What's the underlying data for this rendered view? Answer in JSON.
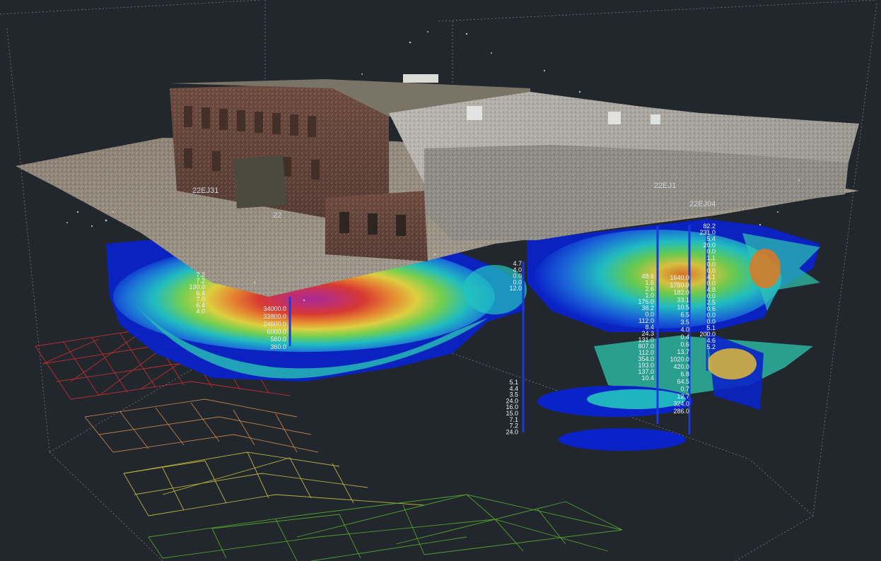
{
  "boreholes": [
    {
      "id": "22EJ31"
    },
    {
      "id": "22EJ04"
    },
    {
      "id": "22EJ1"
    },
    {
      "id": "22"
    }
  ],
  "sample_columns": [
    {
      "values": [
        "7.2",
        "7.2",
        "130.0",
        "6.4",
        "7.0",
        "6.4",
        "4.0"
      ]
    },
    {
      "values": [
        "34000.0",
        "33800.0",
        "24600.0",
        "6000.0",
        "560.0",
        "360.0"
      ]
    },
    {
      "values": [
        "4.7",
        "4.0",
        "0.0",
        "0.0",
        "12.0"
      ]
    },
    {
      "values": [
        "5.1",
        "4.4",
        "3.5",
        "24.0",
        "16.0",
        "15.0",
        "7.1",
        "7.2",
        "24.0"
      ]
    },
    {
      "values": [
        "48.6",
        "1.6",
        "2.6",
        "1.0",
        "176.0",
        "38.2",
        "0.0",
        "112.0",
        "8.4",
        "24.3",
        "131.0",
        "807.0",
        "112.0",
        "354.0",
        "193.0",
        "137.0",
        "10.4"
      ]
    },
    {
      "values": [
        "1640.0",
        "1750.0",
        "182.0",
        "33.1",
        "10.5",
        "6.5",
        "3.5",
        "4.0",
        "0.4",
        "0.6",
        "13.7",
        "1020.0",
        "420.0",
        "6.8",
        "64.5",
        "0.7",
        "12.7",
        "324.0",
        "286.0"
      ]
    },
    {
      "values": [
        "82.2",
        "231.0",
        "5.4",
        "20.0",
        "0.0",
        "1.1",
        "0.0",
        "0.0",
        "4.1",
        "0.0",
        "4.8",
        "0.0",
        "2.5",
        "0.6",
        "0.0",
        "0.0",
        "5.1",
        "200.0",
        "4.6",
        "5.2"
      ]
    }
  ],
  "colors": {
    "background": "#22262d",
    "plume_low": "#0a23c8",
    "plume_mid": "#22c4c0",
    "plume_high": "#e23a2a",
    "plume_peak": "#b02a90",
    "terrain_red": "#d83030",
    "terrain_yellow": "#c8c040",
    "terrain_green": "#54b02a"
  }
}
